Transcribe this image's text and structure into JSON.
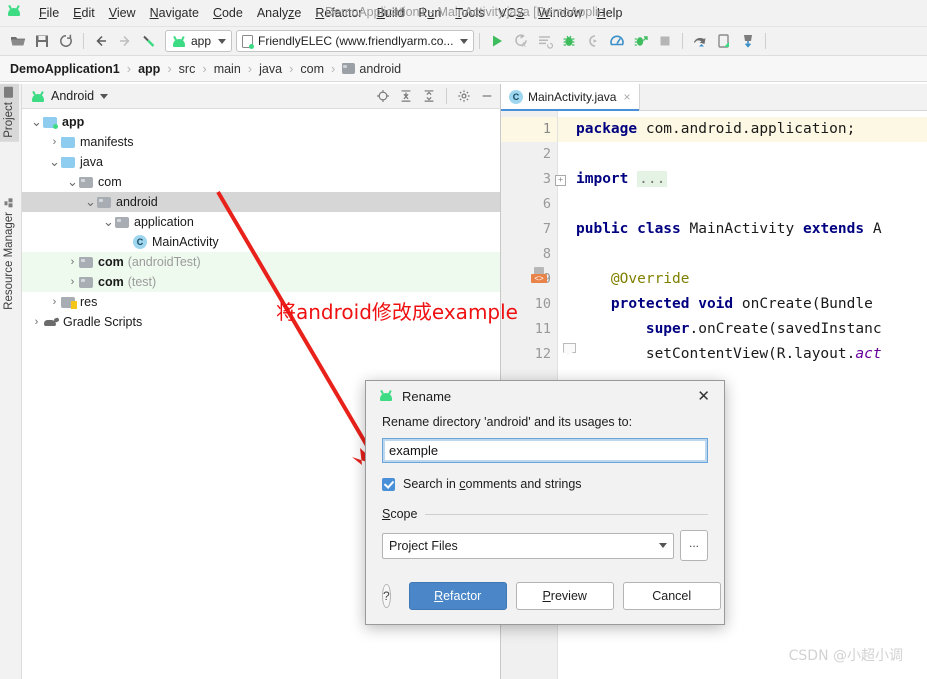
{
  "window": {
    "title": "DemoApplication1 - MainActivity.java [DemoApplic",
    "app_icon": "android-logo-icon"
  },
  "menubar": {
    "items": [
      {
        "label": "File",
        "mnemonic": "F"
      },
      {
        "label": "Edit",
        "mnemonic": "E"
      },
      {
        "label": "View",
        "mnemonic": "V"
      },
      {
        "label": "Navigate",
        "mnemonic": "N"
      },
      {
        "label": "Code",
        "mnemonic": "C"
      },
      {
        "label": "Analyze",
        "mnemonic": "z"
      },
      {
        "label": "Refactor",
        "mnemonic": "R"
      },
      {
        "label": "Build",
        "mnemonic": "B"
      },
      {
        "label": "Run",
        "mnemonic": "u"
      },
      {
        "label": "Tools",
        "mnemonic": "T"
      },
      {
        "label": "VCS",
        "mnemonic": "S"
      },
      {
        "label": "Window",
        "mnemonic": "W"
      },
      {
        "label": "Help",
        "mnemonic": "H"
      }
    ]
  },
  "toolbar": {
    "left_icons": [
      "open-folder-icon",
      "save-all-icon",
      "sync-icon"
    ],
    "nav_icons": [
      "back-arrow-icon",
      "forward-arrow-icon",
      "build-hammer-icon"
    ],
    "run_config": {
      "label": "app",
      "icon": "android-logo-icon"
    },
    "device": {
      "label": "FriendlyELEC (www.friendlyarm.co...",
      "icon": "device-icon"
    },
    "right_icons": [
      "run-icon",
      "apply-changes-icon",
      "apply-code-changes-icon",
      "debug-icon",
      "attach-debugger-icon",
      "profiler-icon",
      "run-with-coverage-icon",
      "stop-icon",
      "sdk-manager-icon",
      "avd-manager-icon",
      "sync-gradle-icon"
    ]
  },
  "breadcrumb": {
    "items": [
      {
        "label": "DemoApplication1",
        "bold": true,
        "icon": null
      },
      {
        "label": "app",
        "bold": true,
        "icon": null
      },
      {
        "label": "src",
        "bold": false,
        "icon": null
      },
      {
        "label": "main",
        "bold": false,
        "icon": null
      },
      {
        "label": "java",
        "bold": false,
        "icon": null
      },
      {
        "label": "com",
        "bold": false,
        "icon": null
      },
      {
        "label": "android",
        "bold": false,
        "icon": "folder-icon"
      }
    ],
    "separator": "›"
  },
  "tool_strip": {
    "items": [
      {
        "label": "Project",
        "icon": "project-folder-icon",
        "selected": true
      },
      {
        "label": "Resource Manager",
        "icon": "resource-manager-icon",
        "selected": false
      }
    ]
  },
  "project_panel": {
    "title": "Android",
    "title_icon": "android-logo-icon",
    "dropdown_caret": "▾",
    "actions": [
      "locate-target-icon",
      "expand-all-icon",
      "collapse-all-icon",
      "settings-gear-icon",
      "hide-panel-icon"
    ],
    "tree": [
      {
        "label": "app",
        "suffix": "",
        "depth": 0,
        "arrow": "⌄",
        "icon": "module-folder-icon",
        "bold": true,
        "state": "normal"
      },
      {
        "label": "manifests",
        "suffix": "",
        "depth": 1,
        "arrow": "›",
        "icon": "blue-folder-icon",
        "bold": false,
        "state": "normal"
      },
      {
        "label": "java",
        "suffix": "",
        "depth": 1,
        "arrow": "⌄",
        "icon": "blue-folder-icon",
        "bold": false,
        "state": "normal"
      },
      {
        "label": "com",
        "suffix": "",
        "depth": 2,
        "arrow": "⌄",
        "icon": "package-folder-icon",
        "bold": false,
        "state": "normal"
      },
      {
        "label": "android",
        "suffix": "",
        "depth": 3,
        "arrow": "⌄",
        "icon": "package-folder-icon",
        "bold": false,
        "state": "selected"
      },
      {
        "label": "application",
        "suffix": "",
        "depth": 4,
        "arrow": "⌄",
        "icon": "package-folder-icon",
        "bold": false,
        "state": "normal"
      },
      {
        "label": "MainActivity",
        "suffix": "",
        "depth": 5,
        "arrow": "",
        "icon": "java-class-icon",
        "bold": false,
        "state": "normal"
      },
      {
        "label": "com",
        "suffix": "(androidTest)",
        "depth": 2,
        "arrow": "›",
        "icon": "package-folder-icon",
        "bold": true,
        "state": "test"
      },
      {
        "label": "com",
        "suffix": "(test)",
        "depth": 2,
        "arrow": "›",
        "icon": "package-folder-icon",
        "bold": true,
        "state": "test"
      },
      {
        "label": "res",
        "suffix": "",
        "depth": 1,
        "arrow": "›",
        "icon": "res-folder-icon",
        "bold": false,
        "state": "normal"
      },
      {
        "label": "Gradle Scripts",
        "suffix": "",
        "depth": 0,
        "arrow": "›",
        "icon": "gradle-elephant-icon",
        "bold": false,
        "state": "normal"
      }
    ]
  },
  "editor": {
    "tab": {
      "label": "MainActivity.java",
      "icon": "java-class-icon",
      "close": "×"
    },
    "gutter_lines": [
      "1",
      "2",
      "3",
      "6",
      "7",
      "8",
      "9",
      "10",
      "11",
      "12"
    ],
    "code_lines": [
      "package com.android.application;",
      "",
      "import ...",
      "",
      "public class MainActivity extends A",
      "",
      "    @Override",
      "    protected void onCreate(Bundle",
      "        super.onCreate(savedInstanc",
      "        setContentView(R.layout.act"
    ]
  },
  "annotation": {
    "text": "将android修改成example",
    "color": "#ef1111"
  },
  "dialog": {
    "title": "Rename",
    "title_icon": "android-logo-icon",
    "close": "✕",
    "prompt": "Rename directory 'android' and its usages to:",
    "input_value": "example",
    "checkbox": {
      "label": "Search in comments and strings",
      "checked": true,
      "mnemonic": "c"
    },
    "scope_label": "Scope",
    "scope_value": "Project Files",
    "scope_browse": "...",
    "help_label": "?",
    "buttons": [
      {
        "label": "Refactor",
        "mnemonic": "R",
        "primary": true
      },
      {
        "label": "Preview",
        "mnemonic": "P",
        "primary": false
      },
      {
        "label": "Cancel",
        "mnemonic": "",
        "primary": false
      }
    ]
  },
  "watermark": {
    "text": "CSDN @小超小调"
  },
  "colors": {
    "accent": "#4a86c8",
    "android_green": "#3ddc84",
    "annotation_red": "#ef1111",
    "selection_gray": "#d6d6d6",
    "test_green": "#effaef",
    "keyword_blue": "#000080"
  }
}
